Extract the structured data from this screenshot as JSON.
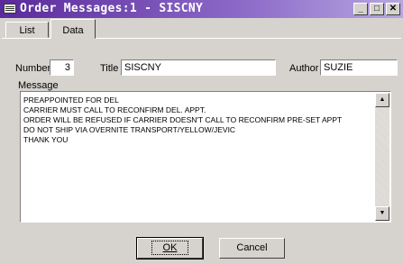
{
  "window": {
    "title": "Order Messages:1 - SISCNY"
  },
  "tabs": [
    {
      "label": "List"
    },
    {
      "label": "Data"
    }
  ],
  "form": {
    "number_label": "Number",
    "number_value": "3",
    "title_label": "Title",
    "title_value": "SISCNY",
    "author_label": "Author",
    "author_value": "SUZIE",
    "message_label": "Message",
    "message_lines": [
      "PREAPPOINTED FOR DEL",
      "CARRIER MUST CALL TO RECONFIRM DEL. APPT.",
      "ORDER WILL BE REFUSED IF CARRIER DOESN'T CALL TO RECONFIRM PRE-SET APPT",
      "DO NOT SHIP VIA OVERNITE TRANSPORT/YELLOW/JEVIC",
      "THANK YOU"
    ]
  },
  "buttons": {
    "ok_label": "OK",
    "cancel_label": "Cancel"
  }
}
